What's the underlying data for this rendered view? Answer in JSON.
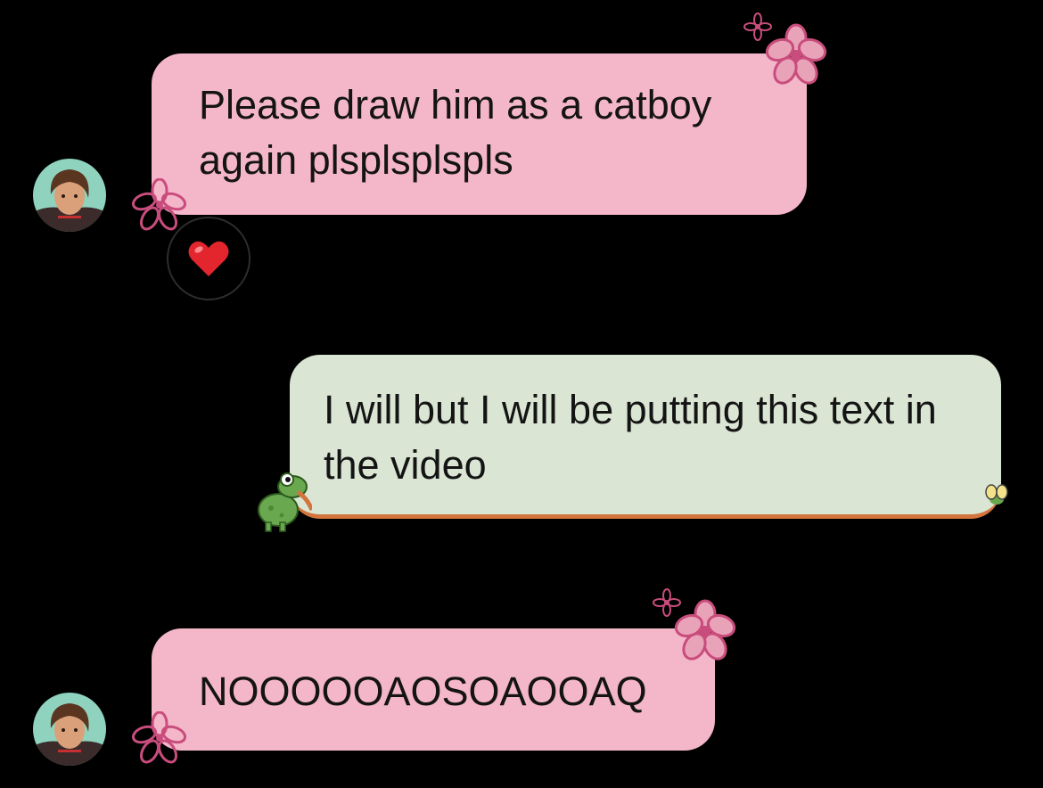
{
  "messages": [
    {
      "sender": "other",
      "text": "Please draw him as a catboy again plsplsplspls",
      "reaction": "heart-emoji"
    },
    {
      "sender": "self",
      "text": "I will but I will be putting this text in the video"
    },
    {
      "sender": "other",
      "text": "NOOOOOAOSOAOOAQ"
    }
  ],
  "colors": {
    "incoming_bubble": "#f4b6c9",
    "outgoing_bubble": "#dae5d3",
    "background": "#000000",
    "flower": "#c94d7c",
    "frog": "#6aa84f",
    "accent_line": "#d2743c"
  }
}
